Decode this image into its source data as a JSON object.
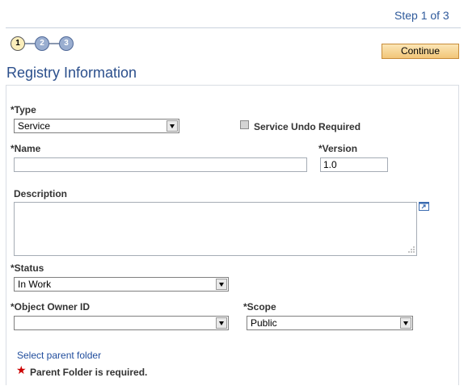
{
  "header": {
    "step_text": "Step 1 of 3"
  },
  "steps": [
    "1",
    "2",
    "3"
  ],
  "toolbar": {
    "continue_label": "Continue"
  },
  "page": {
    "title": "Registry Information"
  },
  "form": {
    "type_label": "*Type",
    "type_value": "Service",
    "undo_label": "Service Undo Required",
    "name_label": "*Name",
    "name_value": "",
    "version_label": "*Version",
    "version_value": "1.0",
    "description_label": "Description",
    "description_value": "",
    "status_label": "*Status",
    "status_value": "In Work",
    "owner_label": "*Object Owner ID",
    "owner_value": "",
    "scope_label": "*Scope",
    "scope_value": "Public",
    "parent_folder_link": "Select parent folder",
    "parent_folder_error": "Parent Folder is required."
  },
  "colors": {
    "title": "#2b4f8c",
    "link": "#1f4c9c",
    "error_star": "#cc0000",
    "button_bg": "#f2c578"
  },
  "icons": {
    "expand": "expand-textarea-icon",
    "required": "required-star-icon"
  }
}
